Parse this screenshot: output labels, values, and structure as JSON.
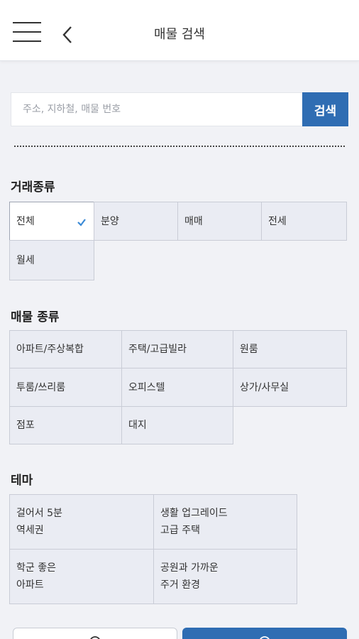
{
  "header": {
    "title": "매물 검색"
  },
  "search": {
    "placeholder": "주소, 지하철, 매물 번호",
    "value": "",
    "button_label": "검색"
  },
  "deal_type": {
    "title": "거래종류",
    "options": [
      {
        "label": "전체",
        "selected": true
      },
      {
        "label": "분양",
        "selected": false
      },
      {
        "label": "매매",
        "selected": false
      },
      {
        "label": "전세",
        "selected": false
      },
      {
        "label": "월세",
        "selected": false
      }
    ]
  },
  "property_type": {
    "title": "매물 종류",
    "options": [
      {
        "label": "아파트/주상복합"
      },
      {
        "label": "주택/고급빌라"
      },
      {
        "label": "원룸"
      },
      {
        "label": "투룸/쓰리룸"
      },
      {
        "label": "오피스텔"
      },
      {
        "label": "상가/사무실"
      },
      {
        "label": "점포"
      },
      {
        "label": "대지"
      }
    ]
  },
  "theme": {
    "title": "테마",
    "options": [
      {
        "label": "걸어서 5분\n역세권"
      },
      {
        "label": "생활 업그레이드\n고급 주택"
      },
      {
        "label": "학군 좋은\n아파트"
      },
      {
        "label": "공원과 가까운\n주거 환경"
      }
    ]
  },
  "colors": {
    "accent": "#2f6db3",
    "check": "#3a8ad6"
  }
}
